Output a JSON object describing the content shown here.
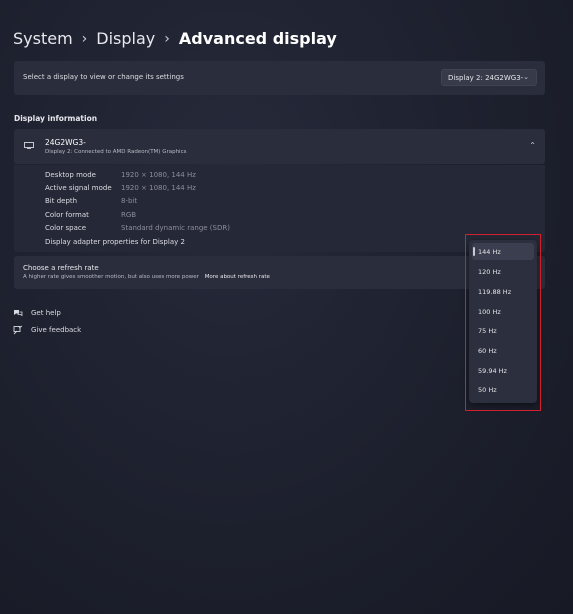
{
  "breadcrumb": {
    "items": [
      "System",
      "Display"
    ],
    "current": "Advanced display",
    "separator": "›"
  },
  "select_display": {
    "label": "Select a display to view or change its settings",
    "selected": "Display 2: 24G2WG3-"
  },
  "display_information": {
    "section_title": "Display information",
    "monitor_name": "24G2WG3-",
    "connection": "Display 2: Connected to AMD Radeon(TM) Graphics",
    "rows": [
      {
        "label": "Desktop mode",
        "value": "1920 × 1080, 144 Hz"
      },
      {
        "label": "Active signal mode",
        "value": "1920 × 1080, 144 Hz"
      },
      {
        "label": "Bit depth",
        "value": "8-bit"
      },
      {
        "label": "Color format",
        "value": "RGB"
      },
      {
        "label": "Color space",
        "value": "Standard dynamic range (SDR)"
      }
    ],
    "adapter_link": "Display adapter properties for Display 2"
  },
  "refresh_rate": {
    "title": "Choose a refresh rate",
    "description": "A higher rate gives smoother motion, but also uses more power",
    "more_link": "More about refresh rate",
    "options": [
      "144 Hz",
      "120 Hz",
      "119.88 Hz",
      "100 Hz",
      "75 Hz",
      "60 Hz",
      "59.94 Hz",
      "50 Hz"
    ],
    "selected_index": 0
  },
  "help": {
    "get_help": "Get help",
    "give_feedback": "Give feedback"
  },
  "colors": {
    "highlight": "#d21f2c",
    "background": "#1e2130",
    "card": "#2a2d3b"
  }
}
